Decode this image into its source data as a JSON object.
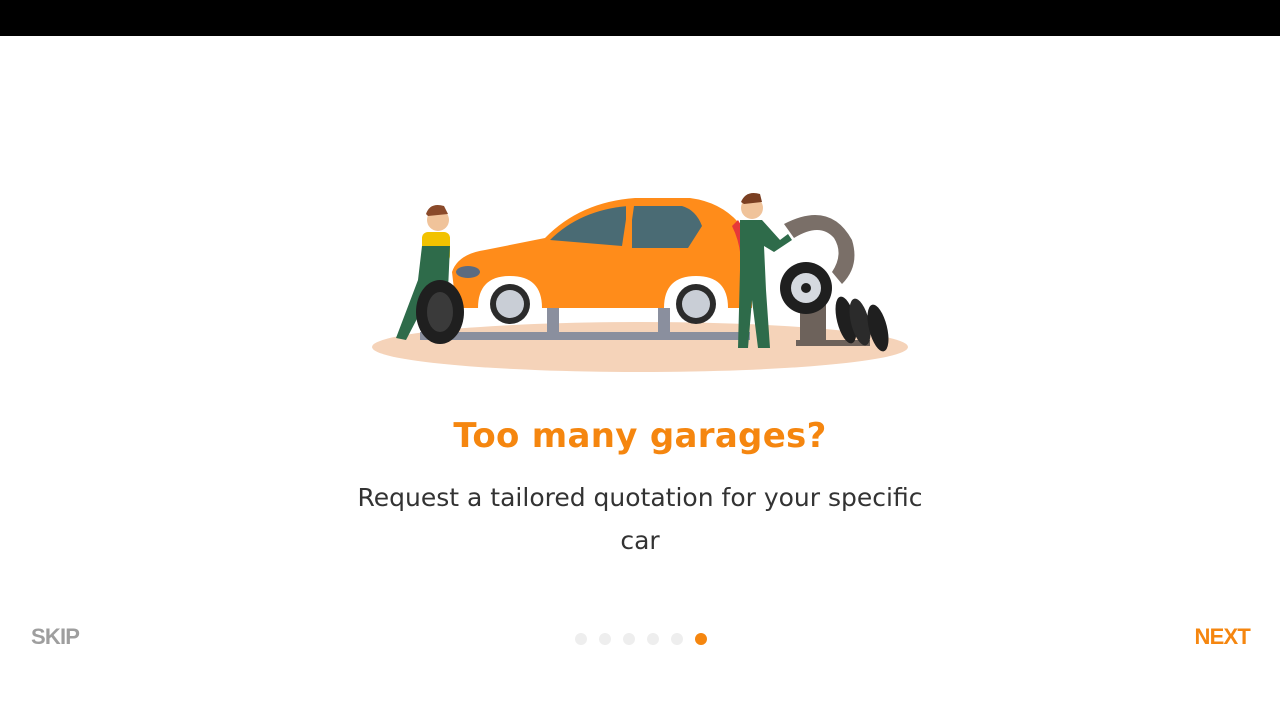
{
  "onboarding": {
    "title": "Too many garages?",
    "description": "Request a tailored quotation for your specific car",
    "skip_label": "SKIP",
    "next_label": "NEXT",
    "total_pages": 6,
    "current_page": 6
  },
  "colors": {
    "accent": "#f5860f",
    "skip_text": "#9e9e9e",
    "body_text": "#333333",
    "dot_inactive": "#eeeeee",
    "status_bar": "#000000"
  },
  "icons": {
    "illustration": "mechanics-car-repair-illustration"
  }
}
